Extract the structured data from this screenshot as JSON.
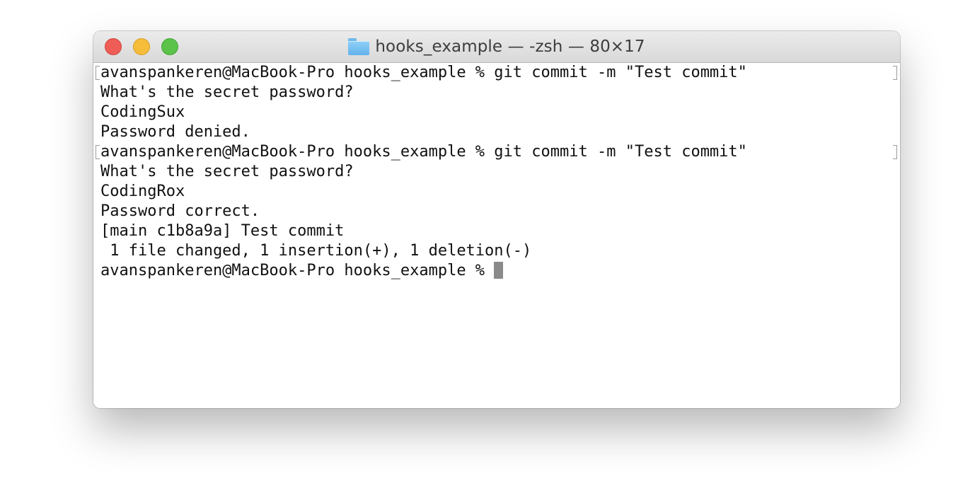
{
  "window": {
    "title": "hooks_example — -zsh — 80×17",
    "folder_icon": "folder-icon"
  },
  "terminal": {
    "lines": [
      "avanspankeren@MacBook-Pro hooks_example % git commit -m \"Test commit\"",
      "What's the secret password?",
      "CodingSux",
      "Password denied.",
      "avanspankeren@MacBook-Pro hooks_example % git commit -m \"Test commit\"",
      "What's the secret password?",
      "CodingRox",
      "Password correct.",
      "[main c1b8a9a] Test commit",
      " 1 file changed, 1 insertion(+), 1 deletion(-)",
      "avanspankeren@MacBook-Pro hooks_example % "
    ]
  },
  "colors": {
    "close": "#ee5d56",
    "minimize": "#f6bd3b",
    "maximize": "#5bc24a",
    "text": "#111111",
    "cursor": "#8a8a8a"
  }
}
